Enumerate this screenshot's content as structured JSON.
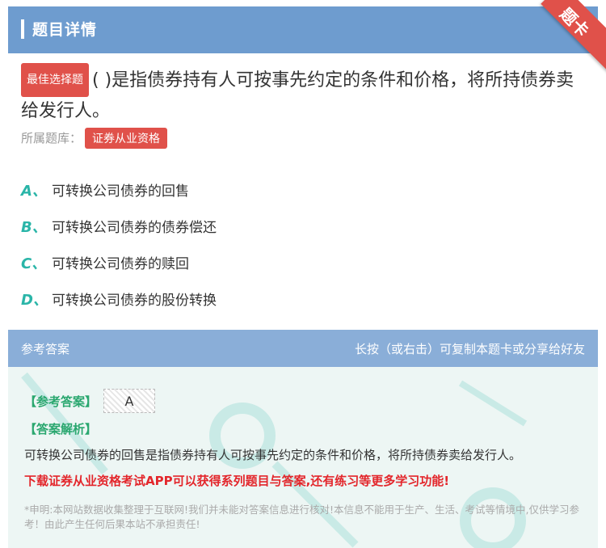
{
  "header": {
    "title": "题目详情",
    "ribbon": "题卡"
  },
  "question": {
    "badge": "最佳选择题",
    "text": "( )是指债券持有人可按事先约定的条件和价格，将所持债券卖给发行人。",
    "source_label": "所属题库：",
    "source_tag": "证券从业资格"
  },
  "options": [
    {
      "letter": "A、",
      "text": "可转换公司债券的回售"
    },
    {
      "letter": "B、",
      "text": "可转换公司债券的债券偿还"
    },
    {
      "letter": "C、",
      "text": "可转换公司债券的赎回"
    },
    {
      "letter": "D、",
      "text": "可转换公司债券的股份转换"
    }
  ],
  "answer_panel": {
    "title": "参考答案",
    "share_hint": "长按（或右击）可复制本题卡或分享给好友",
    "answer_label": "【参考答案】",
    "answer_value": "A",
    "analysis_label": "【答案解析】",
    "analysis_text": "可转换公司债券的回售是指债券持有人可按事先约定的条件和价格，将所持债券卖给发行人。",
    "promo": "下载证券从业资格考试APP可以获得系列题目与答案,还有练习等更多学习功能!",
    "disclaimer": "*申明:本网站数据收集整理于互联网!我们并未能对答案信息进行核对!本信息不能用于生产、生活、考试等情境中,仅供学习参考！由此产生任何后果本站不承担责任!"
  },
  "colors": {
    "header_bg": "#6e9ccf",
    "accent_red": "#e0514a",
    "option_letter": "#2ab5a8",
    "answer_bar": "#8aaed8",
    "answer_body": "#edf6f4",
    "promo_red": "#e3262b",
    "label_green": "#2aa76f"
  }
}
